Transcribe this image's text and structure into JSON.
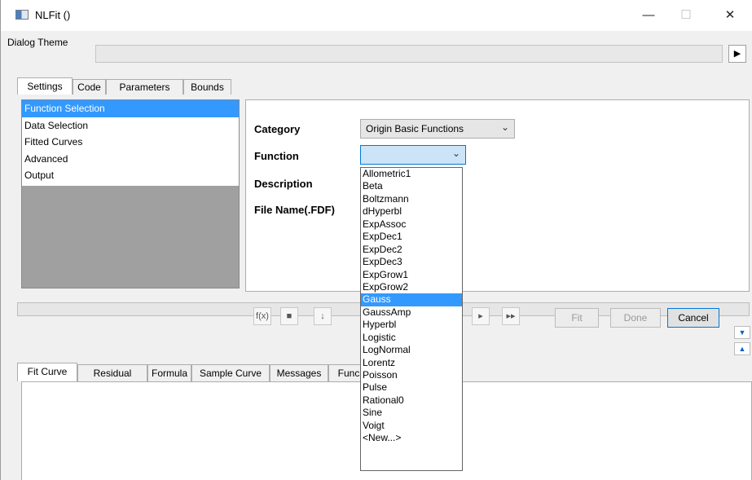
{
  "window": {
    "title": "NLFit ()",
    "controls": {
      "minimize": "—",
      "maximize": "☐",
      "close": "✕"
    }
  },
  "dialog_theme": {
    "label": "Dialog Theme",
    "value": "",
    "arrow": "▶"
  },
  "top_tabs": [
    "Settings",
    "Code",
    "Parameters",
    "Bounds"
  ],
  "settings_list": {
    "items": [
      "Function Selection",
      "Data Selection",
      "Fitted Curves",
      "Advanced",
      "Output"
    ],
    "selected_index": 0
  },
  "function_panel": {
    "category_label": "Category",
    "category_value": "Origin Basic Functions",
    "function_label": "Function",
    "function_value": "",
    "description_label": "Description",
    "filename_label": "File Name(.FDF)"
  },
  "function_dropdown": {
    "options": [
      "Allometric1",
      "Beta",
      "Boltzmann",
      "dHyperbl",
      "ExpAssoc",
      "ExpDec1",
      "ExpDec2",
      "ExpDec3",
      "ExpGrow1",
      "ExpGrow2",
      "Gauss",
      "GaussAmp",
      "Hyperbl",
      "Logistic",
      "LogNormal",
      "Lorentz",
      "Poisson",
      "Pulse",
      "Rational0",
      "Sine",
      "Voigt",
      "<New...>"
    ],
    "highlighted": "Gauss"
  },
  "toolbar": {
    "icons": [
      "f(x)",
      "save",
      "step",
      "iterate",
      "fit",
      "fit-until-converge"
    ],
    "fit_label": "Fit",
    "done_label": "Done",
    "cancel_label": "Cancel"
  },
  "bottom_tabs": [
    "Fit Curve",
    "Residual",
    "Formula",
    "Sample Curve",
    "Messages",
    "Func"
  ]
}
